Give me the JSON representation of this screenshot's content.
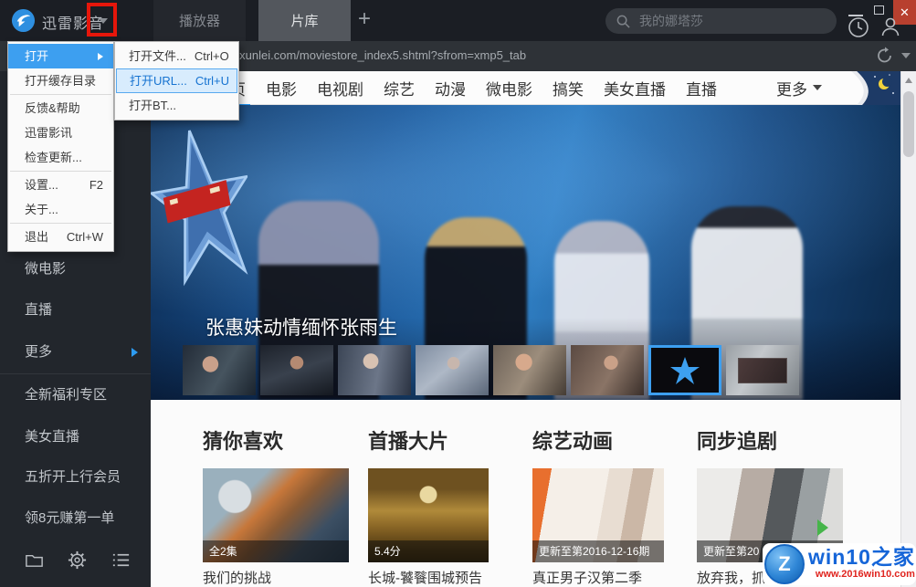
{
  "titlebar": {
    "app_name": "迅雷影音",
    "tabs": [
      {
        "label": "播放器"
      },
      {
        "label": "片库"
      }
    ],
    "new_tab": "+",
    "search_placeholder": "我的娜塔莎"
  },
  "address_bar": {
    "url": "v.xunlei.com/moviestore_index5.shtml?sfrom=xmp5_tab"
  },
  "main_menu": {
    "items": [
      {
        "label": "打开"
      },
      {
        "label": "打开缓存目录"
      },
      {
        "label": "反馈&帮助"
      },
      {
        "label": "迅雷影讯"
      },
      {
        "label": "检查更新..."
      },
      {
        "label": "设置...",
        "shortcut": "F2"
      },
      {
        "label": "关于..."
      },
      {
        "label": "退出",
        "shortcut": "Ctrl+W"
      }
    ]
  },
  "open_submenu": {
    "items": [
      {
        "label": "打开文件...",
        "shortcut": "Ctrl+O"
      },
      {
        "label": "打开URL...",
        "shortcut": "Ctrl+U"
      },
      {
        "label": "打开BT...",
        "shortcut": ""
      }
    ]
  },
  "page_sidebar": {
    "items": [
      {
        "label": "微电影"
      },
      {
        "label": "直播"
      },
      {
        "label": "更多"
      }
    ],
    "promos": [
      {
        "label": "全新福利专区"
      },
      {
        "label": "美女直播"
      },
      {
        "label": "五折开上行会员"
      },
      {
        "label": "领8元赚第一单"
      }
    ]
  },
  "nav": {
    "items": [
      {
        "label": "首页"
      },
      {
        "label": "电影"
      },
      {
        "label": "电视剧"
      },
      {
        "label": "综艺"
      },
      {
        "label": "动漫"
      },
      {
        "label": "微电影"
      },
      {
        "label": "搞笑"
      },
      {
        "label": "美女直播"
      },
      {
        "label": "直播"
      },
      {
        "label": "更多"
      }
    ]
  },
  "hero": {
    "caption": "张惠妹动情缅怀张雨生"
  },
  "sections": [
    {
      "title": "猜你喜欢",
      "badge": "全2集",
      "caption": "我们的挑战"
    },
    {
      "title": "首播大片",
      "badge": "5.4分",
      "caption": "长城-饕餮围城预告"
    },
    {
      "title": "综艺动画",
      "badge": "更新至第2016-12-16期",
      "caption": "真正男子汉第二季"
    },
    {
      "title": "同步追剧",
      "badge": "更新至第20",
      "caption": "放弃我，抓"
    }
  ],
  "watermark": {
    "title": "win10之家",
    "url": "www.2016win10.com"
  },
  "colors": {
    "accent": "#2196f3",
    "menu_highlight": "#3d9ff0",
    "close_red": "#b8402f",
    "red_box": "#e6160b"
  }
}
